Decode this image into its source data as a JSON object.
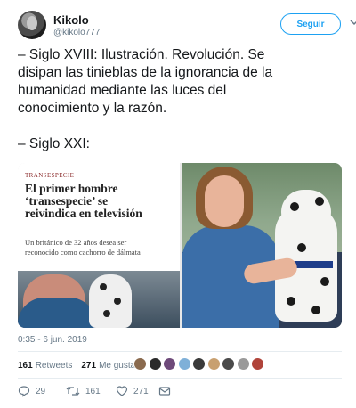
{
  "author": {
    "display_name": "Kikolo",
    "handle": "@kikolo777",
    "avatar_icon": "avatar-photo"
  },
  "follow_button": {
    "label": "Seguir",
    "color": "#1da1f2"
  },
  "menu_icon": "chevron-down-icon",
  "tweet": {
    "paragraph_1": "– Siglo XVIII:  Ilustración. Revolución. Se\ndisipan las tinieblas de la ignorancia de la\nhumanidad mediante las luces del\nconocimiento y la razón.",
    "paragraph_2": "– Siglo XXI:"
  },
  "media": {
    "article": {
      "kicker": "TRANSESPECIE",
      "headline": "El primer hombre\n‘transespecie’ se\nreivindica en televisión",
      "subhead": "Un británico de 32 años desea ser\nreconocido como cachorro de dálmata"
    }
  },
  "timestamp": "0:35 - 6 jun. 2019",
  "stats": {
    "retweets_count": "161",
    "retweets_label": "Retweets",
    "likes_count": "271",
    "likes_label": "Me gusta",
    "liker_avatar_colors": [
      "#8a6a4e",
      "#2b2b2b",
      "#6e4a7a",
      "#7fb0d8",
      "#3a3a3a",
      "#c8a070",
      "#4a4a4a",
      "#9a9a9a",
      "#b0443a"
    ]
  },
  "actions": {
    "reply_count": "29",
    "retweet_count": "161",
    "like_count": "271",
    "reply_icon": "reply-icon",
    "retweet_icon": "retweet-icon",
    "like_icon": "heart-icon",
    "message_icon": "message-icon"
  },
  "colors": {
    "text": "#14171a",
    "secondary": "#657786",
    "accent": "#1da1f2",
    "divider": "#e6ecf0"
  }
}
